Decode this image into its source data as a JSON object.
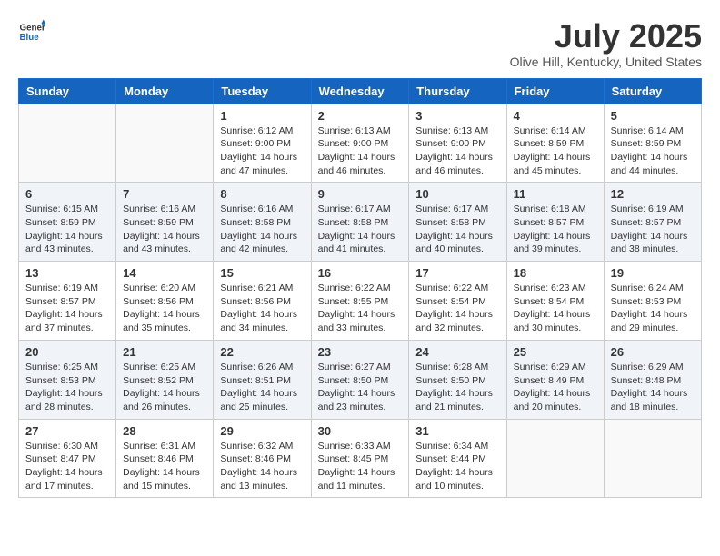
{
  "logo": {
    "general": "General",
    "blue": "Blue"
  },
  "title": "July 2025",
  "subtitle": "Olive Hill, Kentucky, United States",
  "days_of_week": [
    "Sunday",
    "Monday",
    "Tuesday",
    "Wednesday",
    "Thursday",
    "Friday",
    "Saturday"
  ],
  "weeks": [
    [
      {
        "day": "",
        "sunrise": "",
        "sunset": "",
        "daylight": "",
        "empty": true
      },
      {
        "day": "",
        "sunrise": "",
        "sunset": "",
        "daylight": "",
        "empty": true
      },
      {
        "day": "1",
        "sunrise": "Sunrise: 6:12 AM",
        "sunset": "Sunset: 9:00 PM",
        "daylight": "Daylight: 14 hours and 47 minutes.",
        "empty": false
      },
      {
        "day": "2",
        "sunrise": "Sunrise: 6:13 AM",
        "sunset": "Sunset: 9:00 PM",
        "daylight": "Daylight: 14 hours and 46 minutes.",
        "empty": false
      },
      {
        "day": "3",
        "sunrise": "Sunrise: 6:13 AM",
        "sunset": "Sunset: 9:00 PM",
        "daylight": "Daylight: 14 hours and 46 minutes.",
        "empty": false
      },
      {
        "day": "4",
        "sunrise": "Sunrise: 6:14 AM",
        "sunset": "Sunset: 8:59 PM",
        "daylight": "Daylight: 14 hours and 45 minutes.",
        "empty": false
      },
      {
        "day": "5",
        "sunrise": "Sunrise: 6:14 AM",
        "sunset": "Sunset: 8:59 PM",
        "daylight": "Daylight: 14 hours and 44 minutes.",
        "empty": false
      }
    ],
    [
      {
        "day": "6",
        "sunrise": "Sunrise: 6:15 AM",
        "sunset": "Sunset: 8:59 PM",
        "daylight": "Daylight: 14 hours and 43 minutes.",
        "empty": false
      },
      {
        "day": "7",
        "sunrise": "Sunrise: 6:16 AM",
        "sunset": "Sunset: 8:59 PM",
        "daylight": "Daylight: 14 hours and 43 minutes.",
        "empty": false
      },
      {
        "day": "8",
        "sunrise": "Sunrise: 6:16 AM",
        "sunset": "Sunset: 8:58 PM",
        "daylight": "Daylight: 14 hours and 42 minutes.",
        "empty": false
      },
      {
        "day": "9",
        "sunrise": "Sunrise: 6:17 AM",
        "sunset": "Sunset: 8:58 PM",
        "daylight": "Daylight: 14 hours and 41 minutes.",
        "empty": false
      },
      {
        "day": "10",
        "sunrise": "Sunrise: 6:17 AM",
        "sunset": "Sunset: 8:58 PM",
        "daylight": "Daylight: 14 hours and 40 minutes.",
        "empty": false
      },
      {
        "day": "11",
        "sunrise": "Sunrise: 6:18 AM",
        "sunset": "Sunset: 8:57 PM",
        "daylight": "Daylight: 14 hours and 39 minutes.",
        "empty": false
      },
      {
        "day": "12",
        "sunrise": "Sunrise: 6:19 AM",
        "sunset": "Sunset: 8:57 PM",
        "daylight": "Daylight: 14 hours and 38 minutes.",
        "empty": false
      }
    ],
    [
      {
        "day": "13",
        "sunrise": "Sunrise: 6:19 AM",
        "sunset": "Sunset: 8:57 PM",
        "daylight": "Daylight: 14 hours and 37 minutes.",
        "empty": false
      },
      {
        "day": "14",
        "sunrise": "Sunrise: 6:20 AM",
        "sunset": "Sunset: 8:56 PM",
        "daylight": "Daylight: 14 hours and 35 minutes.",
        "empty": false
      },
      {
        "day": "15",
        "sunrise": "Sunrise: 6:21 AM",
        "sunset": "Sunset: 8:56 PM",
        "daylight": "Daylight: 14 hours and 34 minutes.",
        "empty": false
      },
      {
        "day": "16",
        "sunrise": "Sunrise: 6:22 AM",
        "sunset": "Sunset: 8:55 PM",
        "daylight": "Daylight: 14 hours and 33 minutes.",
        "empty": false
      },
      {
        "day": "17",
        "sunrise": "Sunrise: 6:22 AM",
        "sunset": "Sunset: 8:54 PM",
        "daylight": "Daylight: 14 hours and 32 minutes.",
        "empty": false
      },
      {
        "day": "18",
        "sunrise": "Sunrise: 6:23 AM",
        "sunset": "Sunset: 8:54 PM",
        "daylight": "Daylight: 14 hours and 30 minutes.",
        "empty": false
      },
      {
        "day": "19",
        "sunrise": "Sunrise: 6:24 AM",
        "sunset": "Sunset: 8:53 PM",
        "daylight": "Daylight: 14 hours and 29 minutes.",
        "empty": false
      }
    ],
    [
      {
        "day": "20",
        "sunrise": "Sunrise: 6:25 AM",
        "sunset": "Sunset: 8:53 PM",
        "daylight": "Daylight: 14 hours and 28 minutes.",
        "empty": false
      },
      {
        "day": "21",
        "sunrise": "Sunrise: 6:25 AM",
        "sunset": "Sunset: 8:52 PM",
        "daylight": "Daylight: 14 hours and 26 minutes.",
        "empty": false
      },
      {
        "day": "22",
        "sunrise": "Sunrise: 6:26 AM",
        "sunset": "Sunset: 8:51 PM",
        "daylight": "Daylight: 14 hours and 25 minutes.",
        "empty": false
      },
      {
        "day": "23",
        "sunrise": "Sunrise: 6:27 AM",
        "sunset": "Sunset: 8:50 PM",
        "daylight": "Daylight: 14 hours and 23 minutes.",
        "empty": false
      },
      {
        "day": "24",
        "sunrise": "Sunrise: 6:28 AM",
        "sunset": "Sunset: 8:50 PM",
        "daylight": "Daylight: 14 hours and 21 minutes.",
        "empty": false
      },
      {
        "day": "25",
        "sunrise": "Sunrise: 6:29 AM",
        "sunset": "Sunset: 8:49 PM",
        "daylight": "Daylight: 14 hours and 20 minutes.",
        "empty": false
      },
      {
        "day": "26",
        "sunrise": "Sunrise: 6:29 AM",
        "sunset": "Sunset: 8:48 PM",
        "daylight": "Daylight: 14 hours and 18 minutes.",
        "empty": false
      }
    ],
    [
      {
        "day": "27",
        "sunrise": "Sunrise: 6:30 AM",
        "sunset": "Sunset: 8:47 PM",
        "daylight": "Daylight: 14 hours and 17 minutes.",
        "empty": false
      },
      {
        "day": "28",
        "sunrise": "Sunrise: 6:31 AM",
        "sunset": "Sunset: 8:46 PM",
        "daylight": "Daylight: 14 hours and 15 minutes.",
        "empty": false
      },
      {
        "day": "29",
        "sunrise": "Sunrise: 6:32 AM",
        "sunset": "Sunset: 8:46 PM",
        "daylight": "Daylight: 14 hours and 13 minutes.",
        "empty": false
      },
      {
        "day": "30",
        "sunrise": "Sunrise: 6:33 AM",
        "sunset": "Sunset: 8:45 PM",
        "daylight": "Daylight: 14 hours and 11 minutes.",
        "empty": false
      },
      {
        "day": "31",
        "sunrise": "Sunrise: 6:34 AM",
        "sunset": "Sunset: 8:44 PM",
        "daylight": "Daylight: 14 hours and 10 minutes.",
        "empty": false
      },
      {
        "day": "",
        "sunrise": "",
        "sunset": "",
        "daylight": "",
        "empty": true
      },
      {
        "day": "",
        "sunrise": "",
        "sunset": "",
        "daylight": "",
        "empty": true
      }
    ]
  ]
}
